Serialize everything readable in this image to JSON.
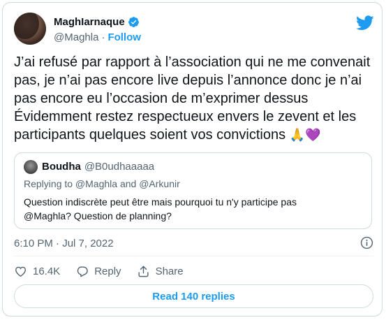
{
  "author": {
    "display_name": "MaghIarnaque",
    "handle": "@Maghla",
    "separator": "·",
    "follow_label": "Follow"
  },
  "tweet": {
    "lines": [
      "J’ai refusé par rapport à l’association qui ne me convenait",
      "pas, je n’ai pas encore live depuis l’annonce donc je n’ai",
      "pas encore eu l’occasion de m’exprimer dessus",
      "Évidemment restez respectueux envers le zevent et les",
      "participants quelques soient vos convictions"
    ],
    "emojis": "🙏💜"
  },
  "quote": {
    "display_name": "Boudha",
    "handle": "@B0udhaaaaa",
    "replying_to": "Replying to @Maghla and @Arkunir",
    "text_lines": [
      "Question indiscrète peut être mais pourquoi tu n'y participe pas",
      "@Maghla? Question de planning?"
    ]
  },
  "timestamp": "6:10 PM · Jul 7, 2022",
  "actions": {
    "like_count": "16.4K",
    "reply_label": "Reply",
    "share_label": "Share"
  },
  "read_replies_label": "Read 140 replies",
  "colors": {
    "accent": "#1d9bf0",
    "muted": "#536471",
    "border": "#cfd9de",
    "verified": "#1d9bf0"
  },
  "icons": [
    "verified-badge-icon",
    "twitter-bird-icon",
    "info-icon",
    "heart-icon",
    "reply-icon",
    "share-icon"
  ]
}
